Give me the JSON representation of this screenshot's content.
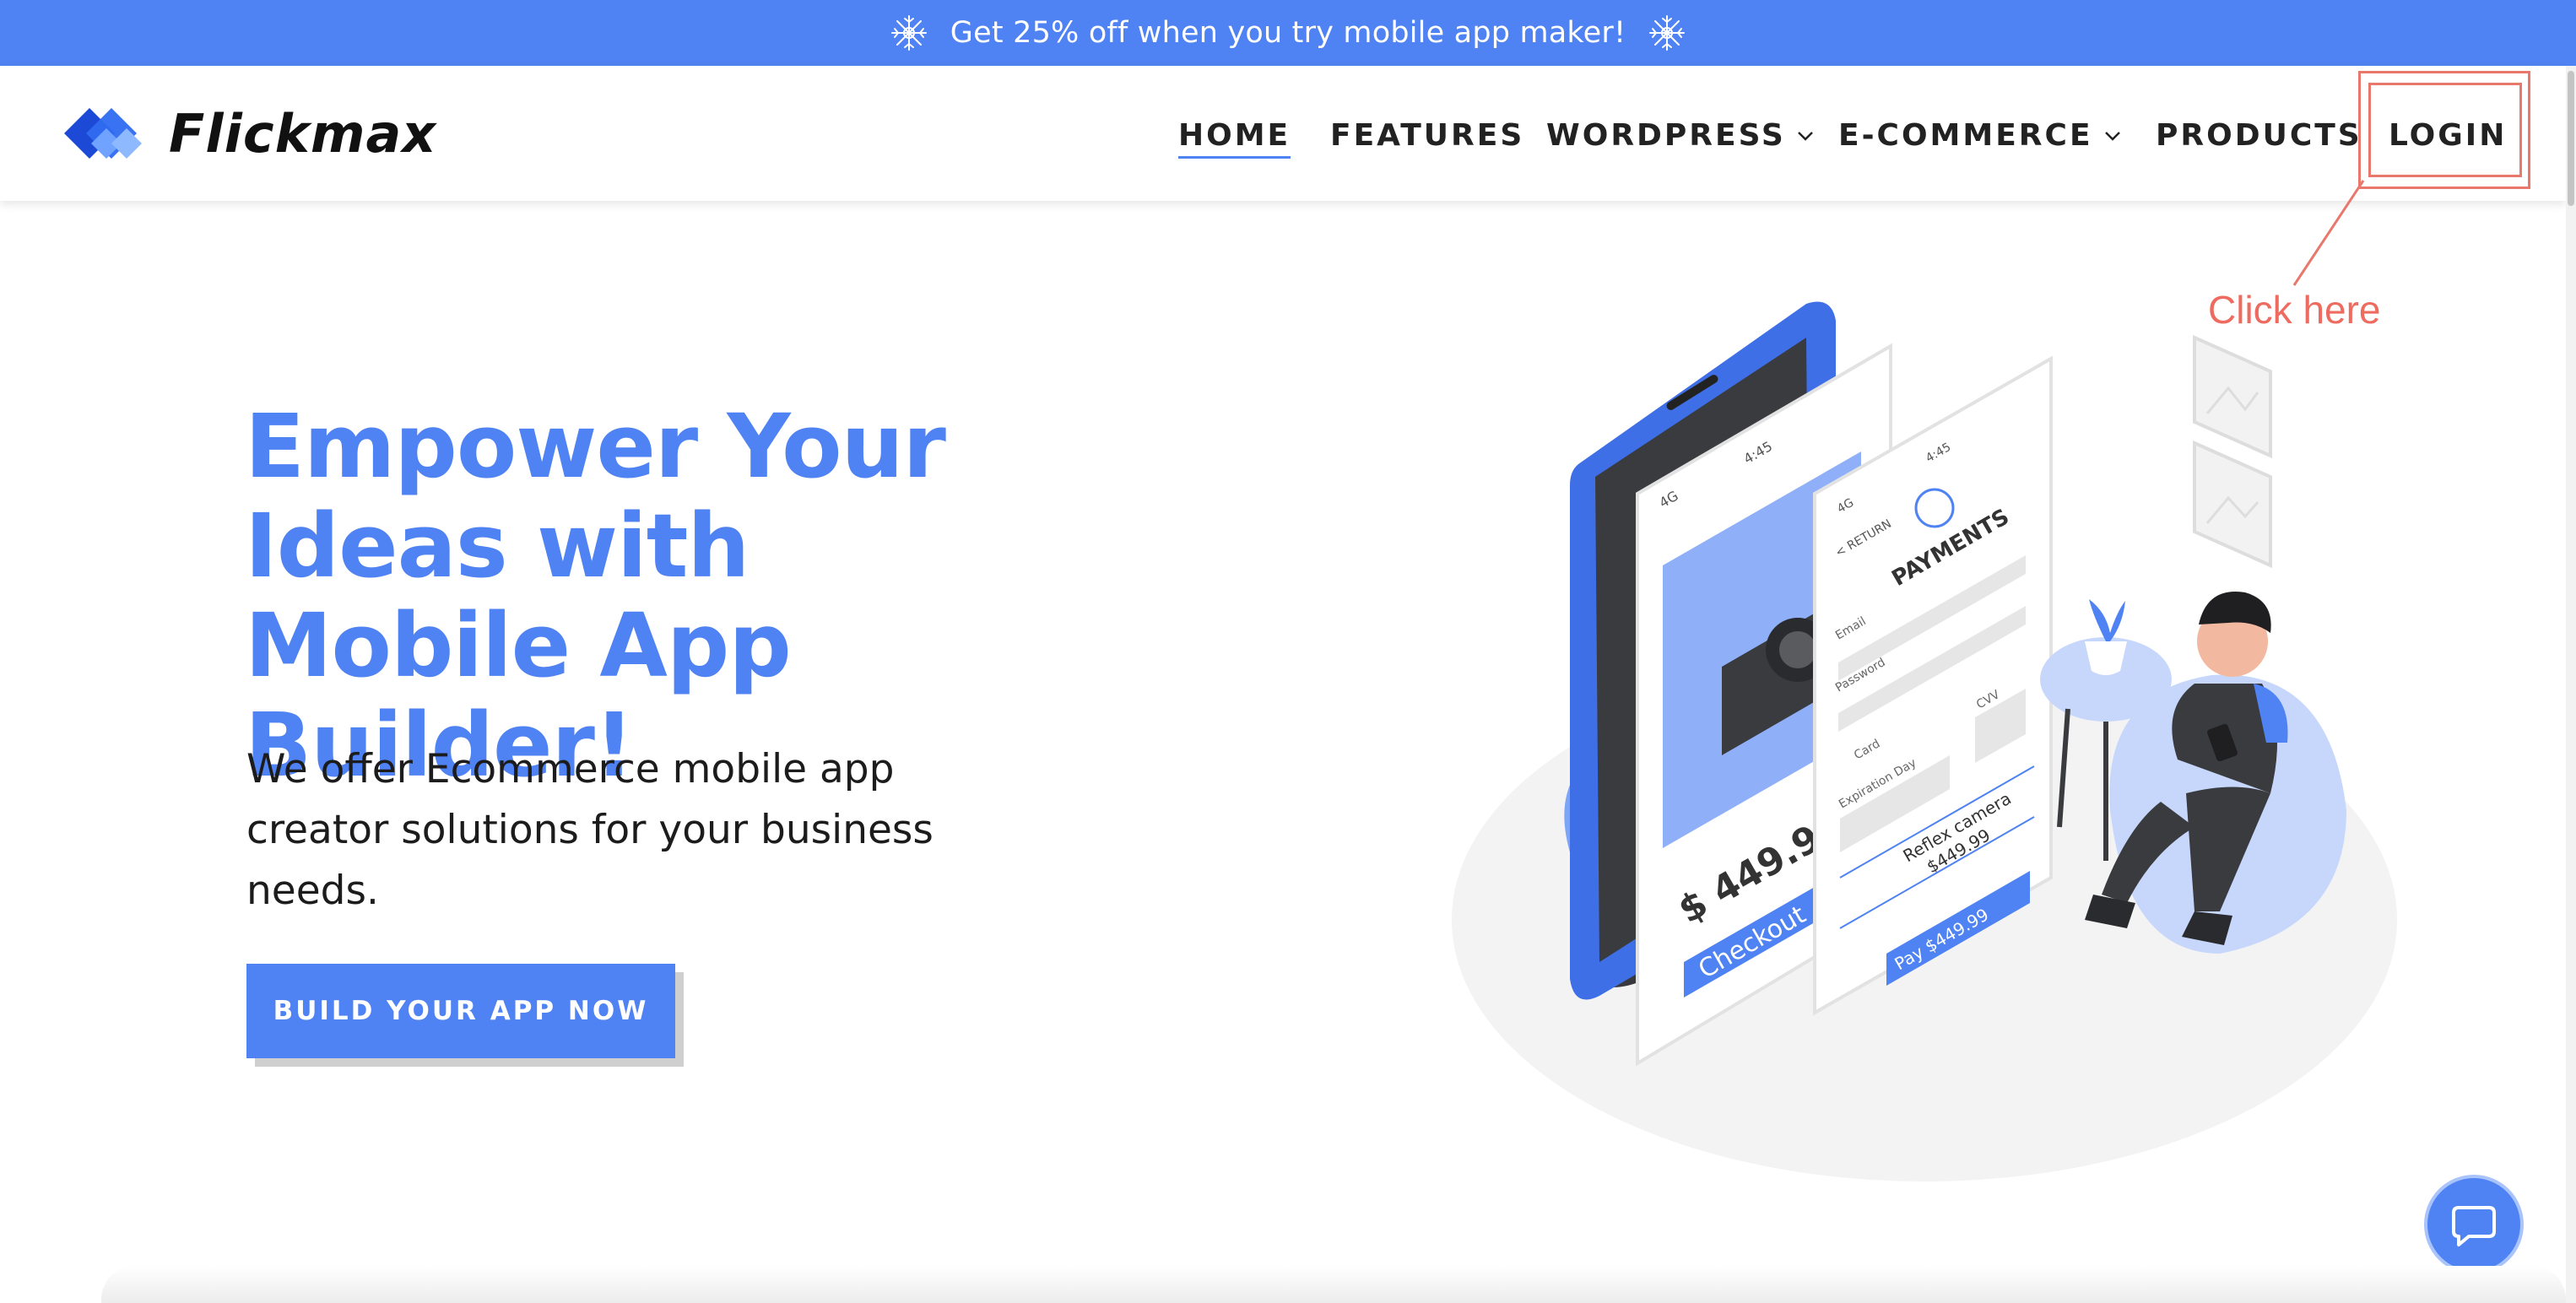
{
  "promo": {
    "text": "Get 25% off when you try mobile app maker!"
  },
  "header": {
    "logo_text": "Flickmax",
    "nav": [
      {
        "label": "HOME",
        "active": true,
        "dropdown": false
      },
      {
        "label": "FEATURES",
        "active": false,
        "dropdown": false
      },
      {
        "label": "WORDPRESS",
        "active": false,
        "dropdown": true
      },
      {
        "label": "E-COMMERCE",
        "active": false,
        "dropdown": true
      },
      {
        "label": "PRODUCTS",
        "active": false,
        "dropdown": false
      },
      {
        "label": "LOGIN",
        "active": false,
        "dropdown": false
      }
    ]
  },
  "annotation": {
    "text": "Click here"
  },
  "hero": {
    "title": "Empower Your Ideas with Mobile App Builder!",
    "subtitle": "We offer Ecommerce mobile app creator solutions for your business needs.",
    "cta_label": "BUILD YOUR APP NOW"
  },
  "illustration": {
    "phone1_time": "4:45",
    "phone1_signal": "4G",
    "phone1_price": "$ 449.99",
    "phone1_checkout": "Checkout",
    "phone2_time": "4:45",
    "phone2_signal": "4G",
    "phone2_return": "< RETURN",
    "phone2_title": "PAYMENTS",
    "phone2_email": "Email",
    "phone2_password": "Password",
    "phone2_card": "Card",
    "phone2_cvv": "CVV",
    "phone2_expiration": "Expiration Day",
    "phone2_product": "Reflex camera",
    "phone2_product_price": "$449.99",
    "phone2_pay": "Pay $449.99"
  },
  "icons": {
    "promo": "snowflake-icon",
    "chevron": "chevron-down-icon",
    "chat": "chat-bubble-icon"
  },
  "colors": {
    "brand_blue": "#4f82f2",
    "annotation_red": "#e8776c"
  }
}
